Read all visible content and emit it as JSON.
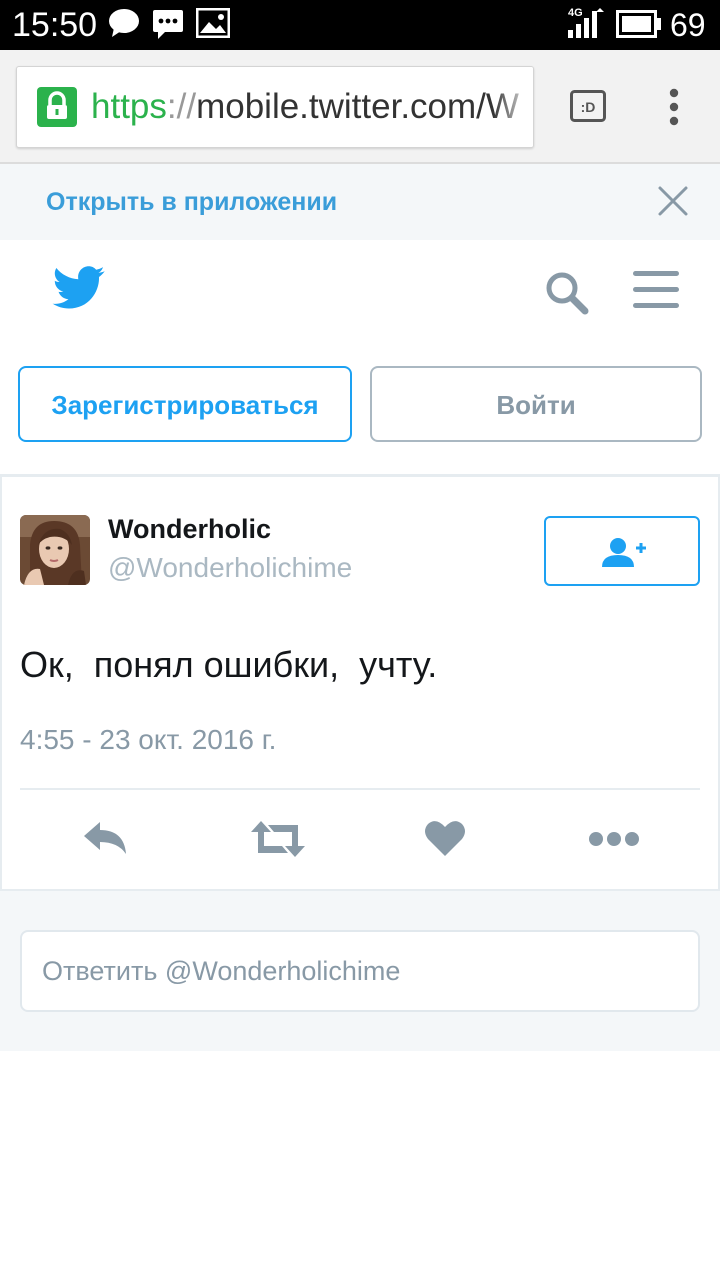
{
  "status_bar": {
    "time": "15:50",
    "network": "4G",
    "battery": "69"
  },
  "browser": {
    "url_scheme": "https",
    "url_sep": "://",
    "url_rest": "mobile.twitter.com/W",
    "tab_label": ":D"
  },
  "app_banner": {
    "text": "Открыть в приложении"
  },
  "auth": {
    "signup_label": "Зарегистрироваться",
    "login_label": "Войти"
  },
  "tweet": {
    "name": "Wonderholic",
    "handle": "@Wonderholichime",
    "text": "Ок,  понял ошибки,  учту.",
    "timestamp": "4:55 - 23 окт. 2016 г."
  },
  "reply": {
    "placeholder": "Ответить @Wonderholichime"
  },
  "colors": {
    "brand": "#1da1f2",
    "muted": "#8899a6",
    "secure": "#2bb24c"
  }
}
